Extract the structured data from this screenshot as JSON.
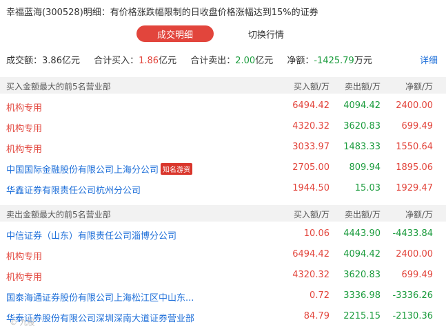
{
  "title": "幸福蓝海(300528)明细：有价格涨跌幅限制的日收盘价格涨幅达到15%的证券",
  "tabs": [
    {
      "label": "成交明细",
      "active": true
    },
    {
      "label": "切换行情",
      "active": false
    }
  ],
  "summary": {
    "turnover_label": "成交额：",
    "turnover_value": "3.86亿元",
    "buy_label": "合计买入：",
    "buy_value": "1.86",
    "buy_unit": "亿元",
    "sell_label": "合计卖出：",
    "sell_value": "2.00",
    "sell_unit": "亿元",
    "net_label": "净额：",
    "net_value": "-1425.79",
    "net_unit": "万元",
    "detail_link": "详细"
  },
  "buy_section": {
    "title": "买入金额最大的前5名营业部",
    "columns": [
      "买入额/万",
      "卖出额/万",
      "净额/万"
    ],
    "rows": [
      {
        "name": "机构专用",
        "type": "org",
        "badge": "",
        "buy": "6494.42",
        "sell": "4094.42",
        "net": "2400.00"
      },
      {
        "name": "机构专用",
        "type": "org",
        "badge": "",
        "buy": "4320.32",
        "sell": "3620.83",
        "net": "699.49"
      },
      {
        "name": "机构专用",
        "type": "org",
        "badge": "",
        "buy": "3033.97",
        "sell": "1483.33",
        "net": "1550.64"
      },
      {
        "name": "中国国际金融股份有限公司上海分公司",
        "type": "broker",
        "badge": "知名游资",
        "buy": "2705.00",
        "sell": "809.94",
        "net": "1895.06"
      },
      {
        "name": "华鑫证券有限责任公司杭州分公司",
        "type": "broker",
        "badge": "",
        "buy": "1944.50",
        "sell": "15.03",
        "net": "1929.47"
      }
    ]
  },
  "sell_section": {
    "title": "卖出金额最大的前5名营业部",
    "columns": [
      "买入额/万",
      "卖出额/万",
      "净额/万"
    ],
    "rows": [
      {
        "name": "中信证券（山东）有限责任公司淄博分公司",
        "type": "broker",
        "badge": "",
        "buy": "10.06",
        "sell": "4443.90",
        "net": "-4433.84"
      },
      {
        "name": "机构专用",
        "type": "org",
        "badge": "",
        "buy": "6494.42",
        "sell": "4094.42",
        "net": "2400.00"
      },
      {
        "name": "机构专用",
        "type": "org",
        "badge": "",
        "buy": "4320.32",
        "sell": "3620.83",
        "net": "699.49"
      },
      {
        "name": "国泰海通证券股份有限公司上海松江区中山东...",
        "type": "broker",
        "badge": "",
        "buy": "0.72",
        "sell": "3336.98",
        "net": "-3336.26"
      },
      {
        "name": "华泰证券股份有限公司深圳深南大道证券营业部",
        "type": "broker",
        "badge": "",
        "buy": "84.79",
        "sell": "2215.15",
        "net": "-2130.36"
      }
    ]
  },
  "colors": {
    "red": "#e2453c",
    "green": "#1a9b3c",
    "blue": "#1e6fd9",
    "header_bg": "#f2f2f2"
  }
}
